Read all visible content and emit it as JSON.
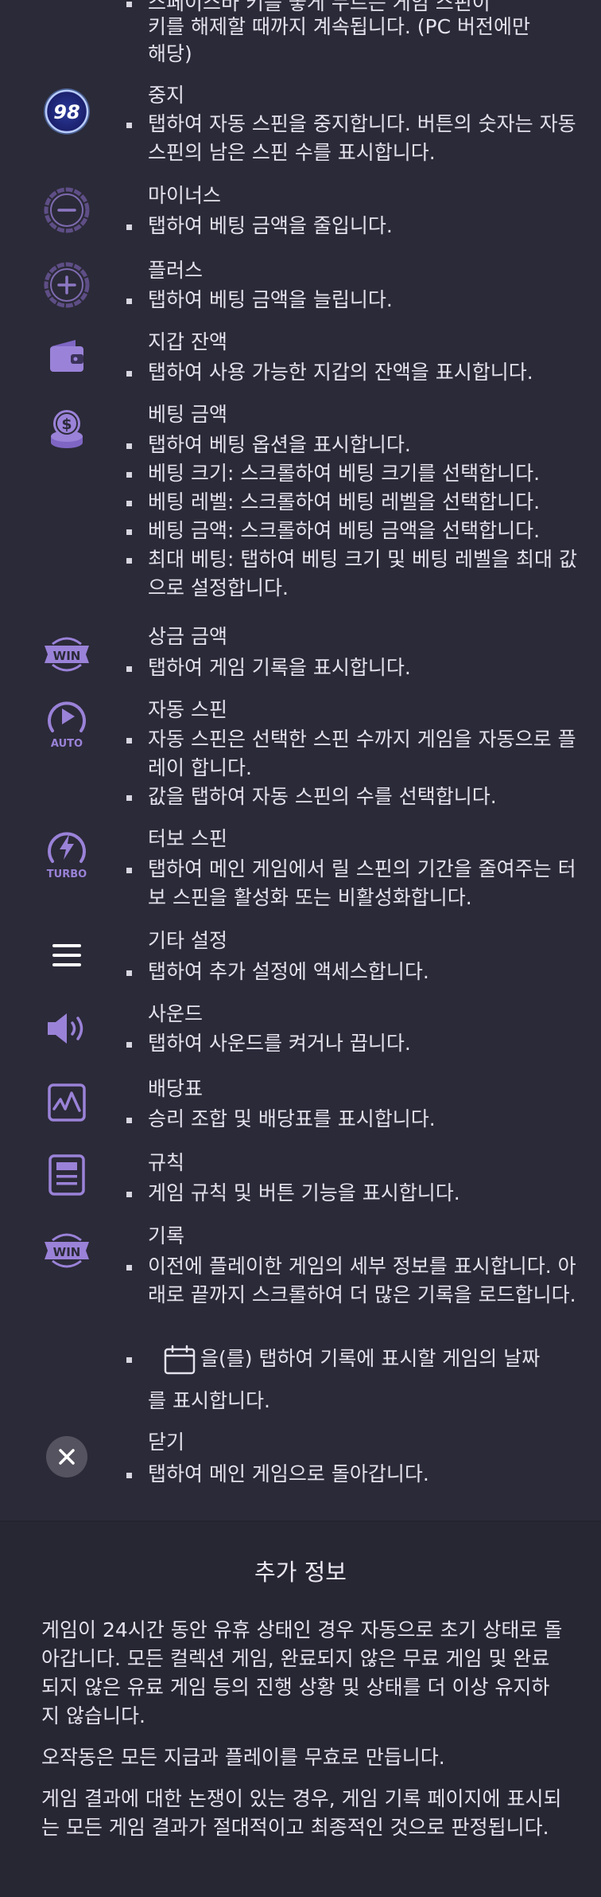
{
  "sections": {
    "top_cut": {
      "lines": [
        "스페이스바 키를 놓게 누르는 게임 스핀이",
        "키를 해제할 때까지 계속됩니다. (PC 버전에만",
        "해당)"
      ]
    },
    "stop": {
      "title": "중지",
      "badge": "98",
      "bullets": [
        "탭하여 자동 스핀을 중지합니다. 버튼의 숫자는 자동 스핀의 남은 스핀 수를 표시합니다."
      ]
    },
    "minus": {
      "title": "마이너스",
      "bullets": [
        "탭하여 베팅 금액을 줄입니다."
      ]
    },
    "plus": {
      "title": "플러스",
      "bullets": [
        "탭하여 베팅 금액을 늘립니다."
      ]
    },
    "wallet": {
      "title": "지갑 잔액",
      "bullets": [
        "탭하여 사용 가능한 지갑의 잔액을 표시합니다."
      ]
    },
    "bet": {
      "title": "베팅 금액",
      "bullets": [
        "탭하여 베팅 옵션을 표시합니다.",
        "베팅 크기: 스크롤하여 베팅 크기를 선택합니다.",
        "베팅 레벨: 스크롤하여 베팅 레벨을 선택합니다.",
        "베팅 금액: 스크롤하여 베팅 금액을 선택합니다.",
        "최대 베팅: 탭하여 베팅 크기 및 베팅 레벨을 최대 값으로 설정합니다."
      ]
    },
    "win": {
      "title": "상금 금액",
      "badge": "WIN",
      "bullets": [
        "탭하여 게임 기록을 표시합니다."
      ]
    },
    "auto": {
      "title": "자동 스핀",
      "badge": "AUTO",
      "bullets": [
        "자동 스핀은 선택한 스핀 수까지 게임을 자동으로 플레이 합니다.",
        "값을 탭하여 자동 스핀의 수를 선택합니다."
      ]
    },
    "turbo": {
      "title": "터보 스핀",
      "badge": "TURBO",
      "bullets": [
        "탭하여 메인 게임에서 릴 스핀의 기간을 줄여주는 터보 스핀을 활성화 또는 비활성화합니다."
      ]
    },
    "menu": {
      "title": "기타 설정",
      "bullets": [
        "탭하여 추가 설정에 액세스합니다."
      ]
    },
    "sound": {
      "title": "사운드",
      "bullets": [
        "탭하여 사운드를 켜거나 끕니다."
      ]
    },
    "paytable": {
      "title": "배당표",
      "bullets": [
        "승리 조합 및 배당표를 표시합니다."
      ]
    },
    "rules": {
      "title": "규칙",
      "bullets": [
        "게임 규칙 및 버튼 기능을 표시합니다."
      ]
    },
    "history": {
      "title": "기록",
      "badge": "WIN",
      "bullets": [
        "이전에 플레이한 게임의 세부 정보를 표시합니다. 아래로 끝까지 스크롤하여 더 많은 기록을 로드합니다."
      ],
      "calendar_line1": "을(를) 탭하여 기록에 표시할 게임의 날짜",
      "calendar_line2": "를 표시합니다."
    },
    "close": {
      "title": "닫기",
      "bullets": [
        "탭하여 메인 게임으로 돌아갑니다."
      ]
    }
  },
  "extra": {
    "title": "추가 정보",
    "paragraphs": [
      "게임이 24시간 동안 유휴 상태인 경우 자동으로 초기 상태로 돌아갑니다. 모든 컬렉션 게임, 완료되지 않은 무료 게임 및 완료되지 않은 유료 게임 등의 진행 상황 및 상태를 더 이상 유지하지 않습니다.",
      "오작동은 모든 지급과 플레이를 무효로 만듭니다.",
      "게임 결과에 대한 논쟁이 있는 경우, 게임 기록 페이지에 표시되는 모든 게임 결과가 절대적이고 최종적인 것으로 판정됩니다."
    ]
  },
  "colors": {
    "background": "#2b2a38",
    "accent": "#9a82d8",
    "text": "#e4e2ec"
  }
}
